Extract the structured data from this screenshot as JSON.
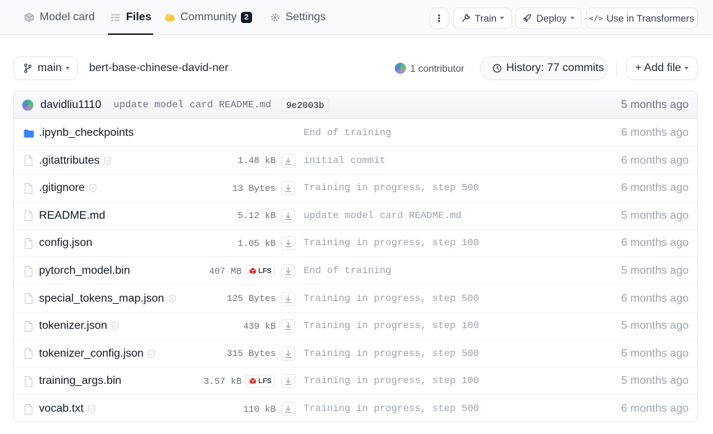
{
  "tabs": {
    "model_card": "Model card",
    "files": "Files",
    "community": "Community",
    "community_count": "2",
    "settings": "Settings"
  },
  "actions": {
    "more": "⋮",
    "train": "Train",
    "deploy": "Deploy",
    "use_in_transformers": "Use in Transformers"
  },
  "branch": {
    "name": "main",
    "repo": "bert-base-chinese-david-ner",
    "contributors": "1 contributor",
    "history": "History: 77 commits",
    "add_file": "+ Add file"
  },
  "last_commit": {
    "author": "davidliu1110",
    "message": "update model card README.md",
    "hash": "9e2003b",
    "date": "5 months ago"
  },
  "files": [
    {
      "name": ".ipynb_checkpoints",
      "type": "folder",
      "size": "",
      "lfs": false,
      "safe": false,
      "message": "End of training",
      "date": "6 months ago"
    },
    {
      "name": ".gitattributes",
      "type": "file",
      "size": "1.48 kB",
      "lfs": false,
      "safe": true,
      "message": "initial commit",
      "date": "6 months ago"
    },
    {
      "name": ".gitignore",
      "type": "file",
      "size": "13 Bytes",
      "lfs": false,
      "safe": true,
      "message": "Training in progress, step 500",
      "date": "6 months ago"
    },
    {
      "name": "README.md",
      "type": "file",
      "size": "5.12 kB",
      "lfs": false,
      "safe": false,
      "message": "update model card README.md",
      "date": "5 months ago"
    },
    {
      "name": "config.json",
      "type": "file",
      "size": "1.05 kB",
      "lfs": false,
      "safe": false,
      "message": "Training in progress, step 100",
      "date": "6 months ago"
    },
    {
      "name": "pytorch_model.bin",
      "type": "file",
      "size": "407 MB",
      "lfs": true,
      "safe": false,
      "message": "End of training",
      "date": "5 months ago"
    },
    {
      "name": "special_tokens_map.json",
      "type": "file",
      "size": "125 Bytes",
      "lfs": false,
      "safe": true,
      "message": "Training in progress, step 500",
      "date": "6 months ago"
    },
    {
      "name": "tokenizer.json",
      "type": "file",
      "size": "439 kB",
      "lfs": false,
      "safe": true,
      "message": "Training in progress, step 100",
      "date": "5 months ago"
    },
    {
      "name": "tokenizer_config.json",
      "type": "file",
      "size": "315 Bytes",
      "lfs": false,
      "safe": true,
      "message": "Training in progress, step 500",
      "date": "6 months ago"
    },
    {
      "name": "training_args.bin",
      "type": "file",
      "size": "3.57 kB",
      "lfs": true,
      "safe": false,
      "message": "Training in progress, step 100",
      "date": "5 months ago"
    },
    {
      "name": "vocab.txt",
      "type": "file",
      "size": "110 kB",
      "lfs": false,
      "safe": true,
      "message": "Training in progress, step 500",
      "date": "6 months ago"
    }
  ],
  "lfs_label": "LFS",
  "colors": {
    "folder": "#3b82f6",
    "lfs_cube": "#dc2626",
    "accent_text": "#111827",
    "muted_text": "#9ca3af"
  }
}
